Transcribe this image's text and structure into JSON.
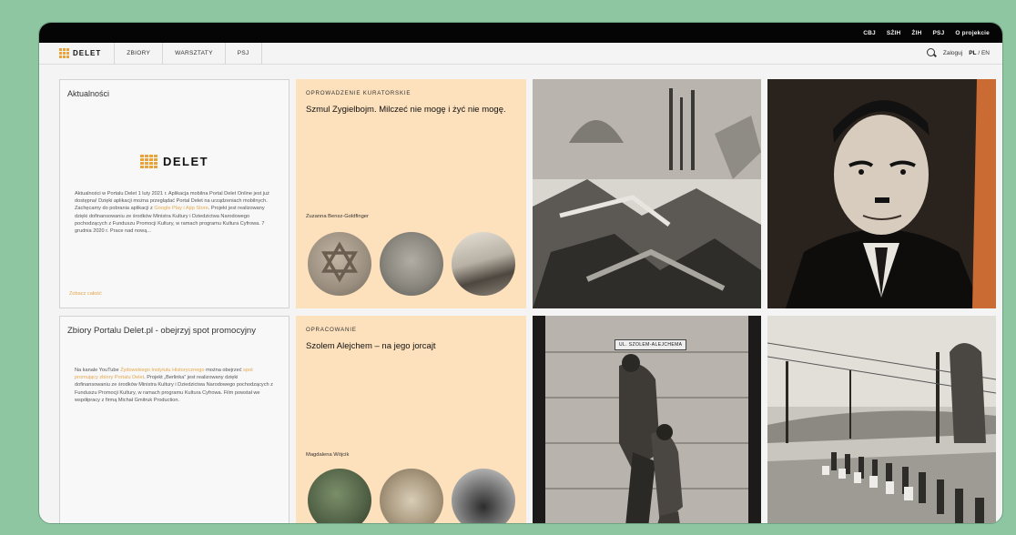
{
  "topbar": {
    "links": [
      "CBJ",
      "SŻIH",
      "ŻIH",
      "PSJ",
      "O projekcie"
    ]
  },
  "nav": {
    "logo": "DELET",
    "tabs": [
      "ZBIORY",
      "WARSZTATY",
      "PSJ"
    ],
    "login": "Zaloguj",
    "lang_pl": "PL",
    "lang_sep": "/",
    "lang_en": "EN"
  },
  "news1": {
    "title": "Aktualności",
    "logo": "DELET",
    "text_before_link": "Aktualności w Portalu Delet 1 luty 2021 r. Aplikacja mobilna Portal Delet Online jest już dostępna! Dzięki aplikacji można przeglądać Portal Delet na urządzeniach mobilnych. Zachęcamy do pobrania aplikacji z",
    "link": "Google Play i App Store",
    "text_after_link": ". Projekt jest realizowany dzięki dofinansowaniu ze środków Ministra Kultury i Dziedzictwa Narodowego pochodzących z Funduszu Promocji Kultury, w ramach programu Kultura Cyfrowa. 7 grudnia 2020 r. Prace nad nową...",
    "more": "Zobacz całość"
  },
  "news2": {
    "title": "Zbiory Portalu Delet.pl - obejrzyj spot promocyjny",
    "text_1": "Na kanale YouTube",
    "link_1": "Żydowskiego Instytutu Historycznego",
    "text_2": "można obejrzeć",
    "link_2": "spot promujący zbiory Portalu Delet",
    "text_3": ". Projekt „Berlinka” jest realizowany dzięki dofinansowaniu ze środków Ministra Kultury i Dziedzictwa Narodowego pochodzących z Funduszu Promocji Kultury, w ramach programu Kultura Cyfrowa. Film powstał we współpracy z firmą Michał Gmitruk Production."
  },
  "curated1": {
    "kicker": "OPROWADZENIE KURATORSKIE",
    "title": "Szmul Zygielbojm. Milczeć nie mogę i żyć nie mogę.",
    "author": "Zuzanna Bensz-Goldfinger"
  },
  "curated2": {
    "kicker": "OPRACOWANIE",
    "title": "Szolem Alejchem – na jego jorcajt",
    "author": "Magdalena Wójcik"
  },
  "photos": {
    "sign_text": "UL. SZOLEM-ALEJCHEMA"
  },
  "colors": {
    "background": "#8dc6a1",
    "accent": "#e3a64d",
    "card_peach": "#fde0bc",
    "topbar": "#050505"
  }
}
